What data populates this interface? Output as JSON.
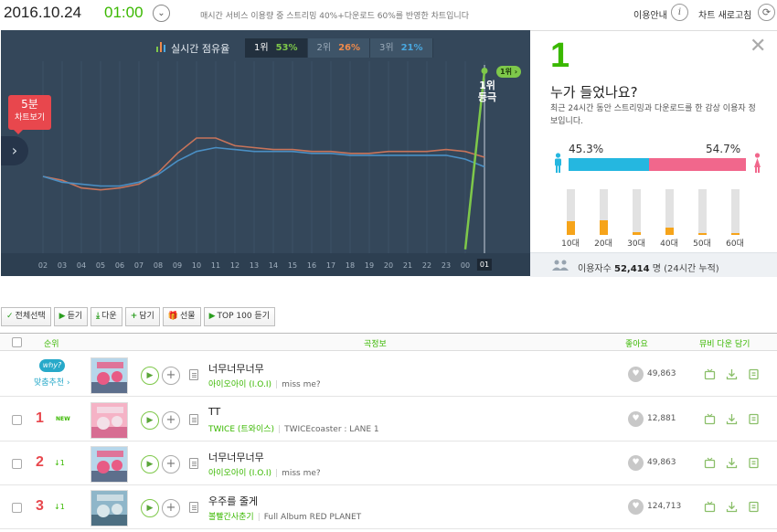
{
  "header": {
    "date": "2016.10.24",
    "time": "01:00",
    "time_toggle": "⌄",
    "description": "매시간 서비스 이용량 중 스트리밍 40%+다운로드 60%를 반영한 차트입니다",
    "guide_label": "이용안내",
    "guide_icon": "i",
    "refresh_label": "차트 새로고침",
    "refresh_icon": "⟳"
  },
  "graph": {
    "title": "실시간 점유율",
    "tabs": [
      {
        "label": "1위",
        "pct": "53%",
        "color": "#7ec84a"
      },
      {
        "label": "2위",
        "pct": "26%",
        "color": "#f08a4b"
      },
      {
        "label": "3위",
        "pct": "21%",
        "color": "#49a8e0"
      }
    ],
    "five_min_num": "5분",
    "five_min_label": "차트보기",
    "side_arrow": "›",
    "peak_label_1": "1위",
    "peak_label_2": "등극",
    "peak_tag": "1위 ›",
    "hours": [
      "02",
      "03",
      "04",
      "05",
      "06",
      "07",
      "08",
      "09",
      "10",
      "11",
      "12",
      "13",
      "14",
      "15",
      "16",
      "17",
      "18",
      "19",
      "20",
      "21",
      "22",
      "23",
      "00",
      "01"
    ]
  },
  "chart_data": {
    "type": "line",
    "x": [
      "02",
      "03",
      "04",
      "05",
      "06",
      "07",
      "08",
      "09",
      "10",
      "11",
      "12",
      "13",
      "14",
      "15",
      "16",
      "17",
      "18",
      "19",
      "20",
      "21",
      "22",
      "23",
      "00",
      "01"
    ],
    "series": [
      {
        "name": "2위",
        "color": "#c8745a",
        "values": [
          40,
          38,
          34,
          33,
          34,
          36,
          42,
          52,
          60,
          60,
          56,
          55,
          54,
          54,
          53,
          53,
          52,
          52,
          53,
          53,
          53,
          54,
          53,
          50
        ]
      },
      {
        "name": "3위",
        "color": "#4a8fc4",
        "values": [
          40,
          37,
          36,
          35,
          35,
          37,
          41,
          48,
          53,
          55,
          54,
          53,
          53,
          53,
          52,
          52,
          51,
          51,
          51,
          51,
          51,
          51,
          49,
          45
        ]
      },
      {
        "name": "1위",
        "color": "#7ec84a",
        "values": [
          null,
          null,
          null,
          null,
          null,
          null,
          null,
          null,
          null,
          null,
          null,
          null,
          null,
          null,
          null,
          null,
          null,
          null,
          null,
          null,
          null,
          null,
          2,
          95
        ]
      }
    ],
    "ylim": [
      0,
      100
    ]
  },
  "info": {
    "rank": "1",
    "close_icon": "✕",
    "question": "누가 들었나요?",
    "description": "최근 24시간 동안 스트리밍과 다운로드를 한 감상 이용자 정보입니다.",
    "male_pct": "45.3%",
    "female_pct": "54.7%",
    "male_share": 0.453,
    "ages": [
      {
        "label": "10대",
        "value": 0.3
      },
      {
        "label": "20대",
        "value": 0.32
      },
      {
        "label": "30대",
        "value": 0.06
      },
      {
        "label": "40대",
        "value": 0.16
      },
      {
        "label": "50대",
        "value": 0.04
      },
      {
        "label": "60대",
        "value": 0.02
      }
    ],
    "users_label": "이용자수",
    "users_count": "52,414",
    "users_suffix": "명 (24시간 누적)"
  },
  "toolbar": [
    {
      "icon": "✓",
      "label": "전체선택",
      "name": "select-all-button"
    },
    {
      "icon": "▶",
      "label": "듣기",
      "name": "listen-button"
    },
    {
      "icon": "⤓",
      "label": "다운",
      "name": "download-button"
    },
    {
      "icon": "+",
      "label": "담기",
      "name": "add-button"
    },
    {
      "icon": "🎁",
      "label": "선물",
      "name": "gift-button"
    },
    {
      "icon": "▶",
      "label": "TOP 100 듣기",
      "name": "top100-button"
    }
  ],
  "table": {
    "headers": {
      "rank": "순위",
      "info": "곡정보",
      "likes": "좋아요",
      "actions": "뮤비 다운 담기"
    },
    "rec": {
      "why": "why?",
      "label": "맞춤추천 ›",
      "song": "너무너무너무",
      "artist": "아이오아이 (I.O.I)",
      "album": "miss me?",
      "likes": "49,863"
    },
    "rows": [
      {
        "rank": "1",
        "change": "NEW",
        "song": "TT",
        "artist": "TWICE (트와이스)",
        "album": "TWICEcoaster : LANE 1",
        "likes": "12,881"
      },
      {
        "rank": "2",
        "change": "↓1",
        "song": "너무너무너무",
        "artist": "아이오아이 (I.O.I)",
        "album": "miss me?",
        "likes": "49,863"
      },
      {
        "rank": "3",
        "change": "↓1",
        "song": "우주를 줄게",
        "artist": "볼빨간사춘기",
        "album": "Full Album RED PLANET",
        "likes": "124,713"
      }
    ]
  },
  "colors": {
    "accent": "#3ab800",
    "rank_red": "#e8474d",
    "male": "#25b7e0",
    "female": "#f1678c"
  }
}
